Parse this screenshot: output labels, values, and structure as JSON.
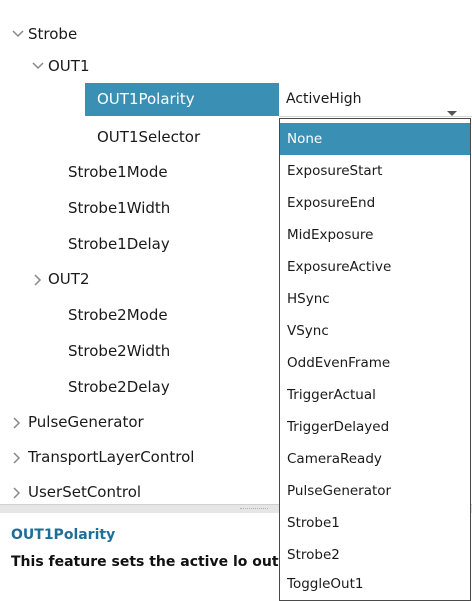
{
  "tree": {
    "strobe": "Strobe",
    "out1": "OUT1",
    "out1_polarity": "OUT1Polarity",
    "out1_selector": "OUT1Selector",
    "strobe1_mode": "Strobe1Mode",
    "strobe1_width": "Strobe1Width",
    "strobe1_delay": "Strobe1Delay",
    "out2": "OUT2",
    "strobe2_mode": "Strobe2Mode",
    "strobe2_width": "Strobe2Width",
    "strobe2_delay": "Strobe2Delay",
    "pulse_generator": "PulseGenerator",
    "transport_layer_control": "TransportLayerControl",
    "user_set_control": "UserSetControl"
  },
  "combo": {
    "value": "ActiveHigh",
    "icon": "chevron-down-icon"
  },
  "dropdown": {
    "options": [
      "None",
      "ExposureStart",
      "ExposureEnd",
      "MidExposure",
      "ExposureActive",
      "HSync",
      "VSync",
      "OddEvenFrame",
      "TriggerActual",
      "TriggerDelayed",
      "CameraReady",
      "PulseGenerator",
      "Strobe1",
      "Strobe2",
      "ToggleOut1"
    ],
    "selected_index": 0
  },
  "description": {
    "title": "OUT1Polarity",
    "text": "This feature sets the active lo output."
  },
  "colors": {
    "selection": "#3a8fb4",
    "description_title": "#1f6e99"
  }
}
